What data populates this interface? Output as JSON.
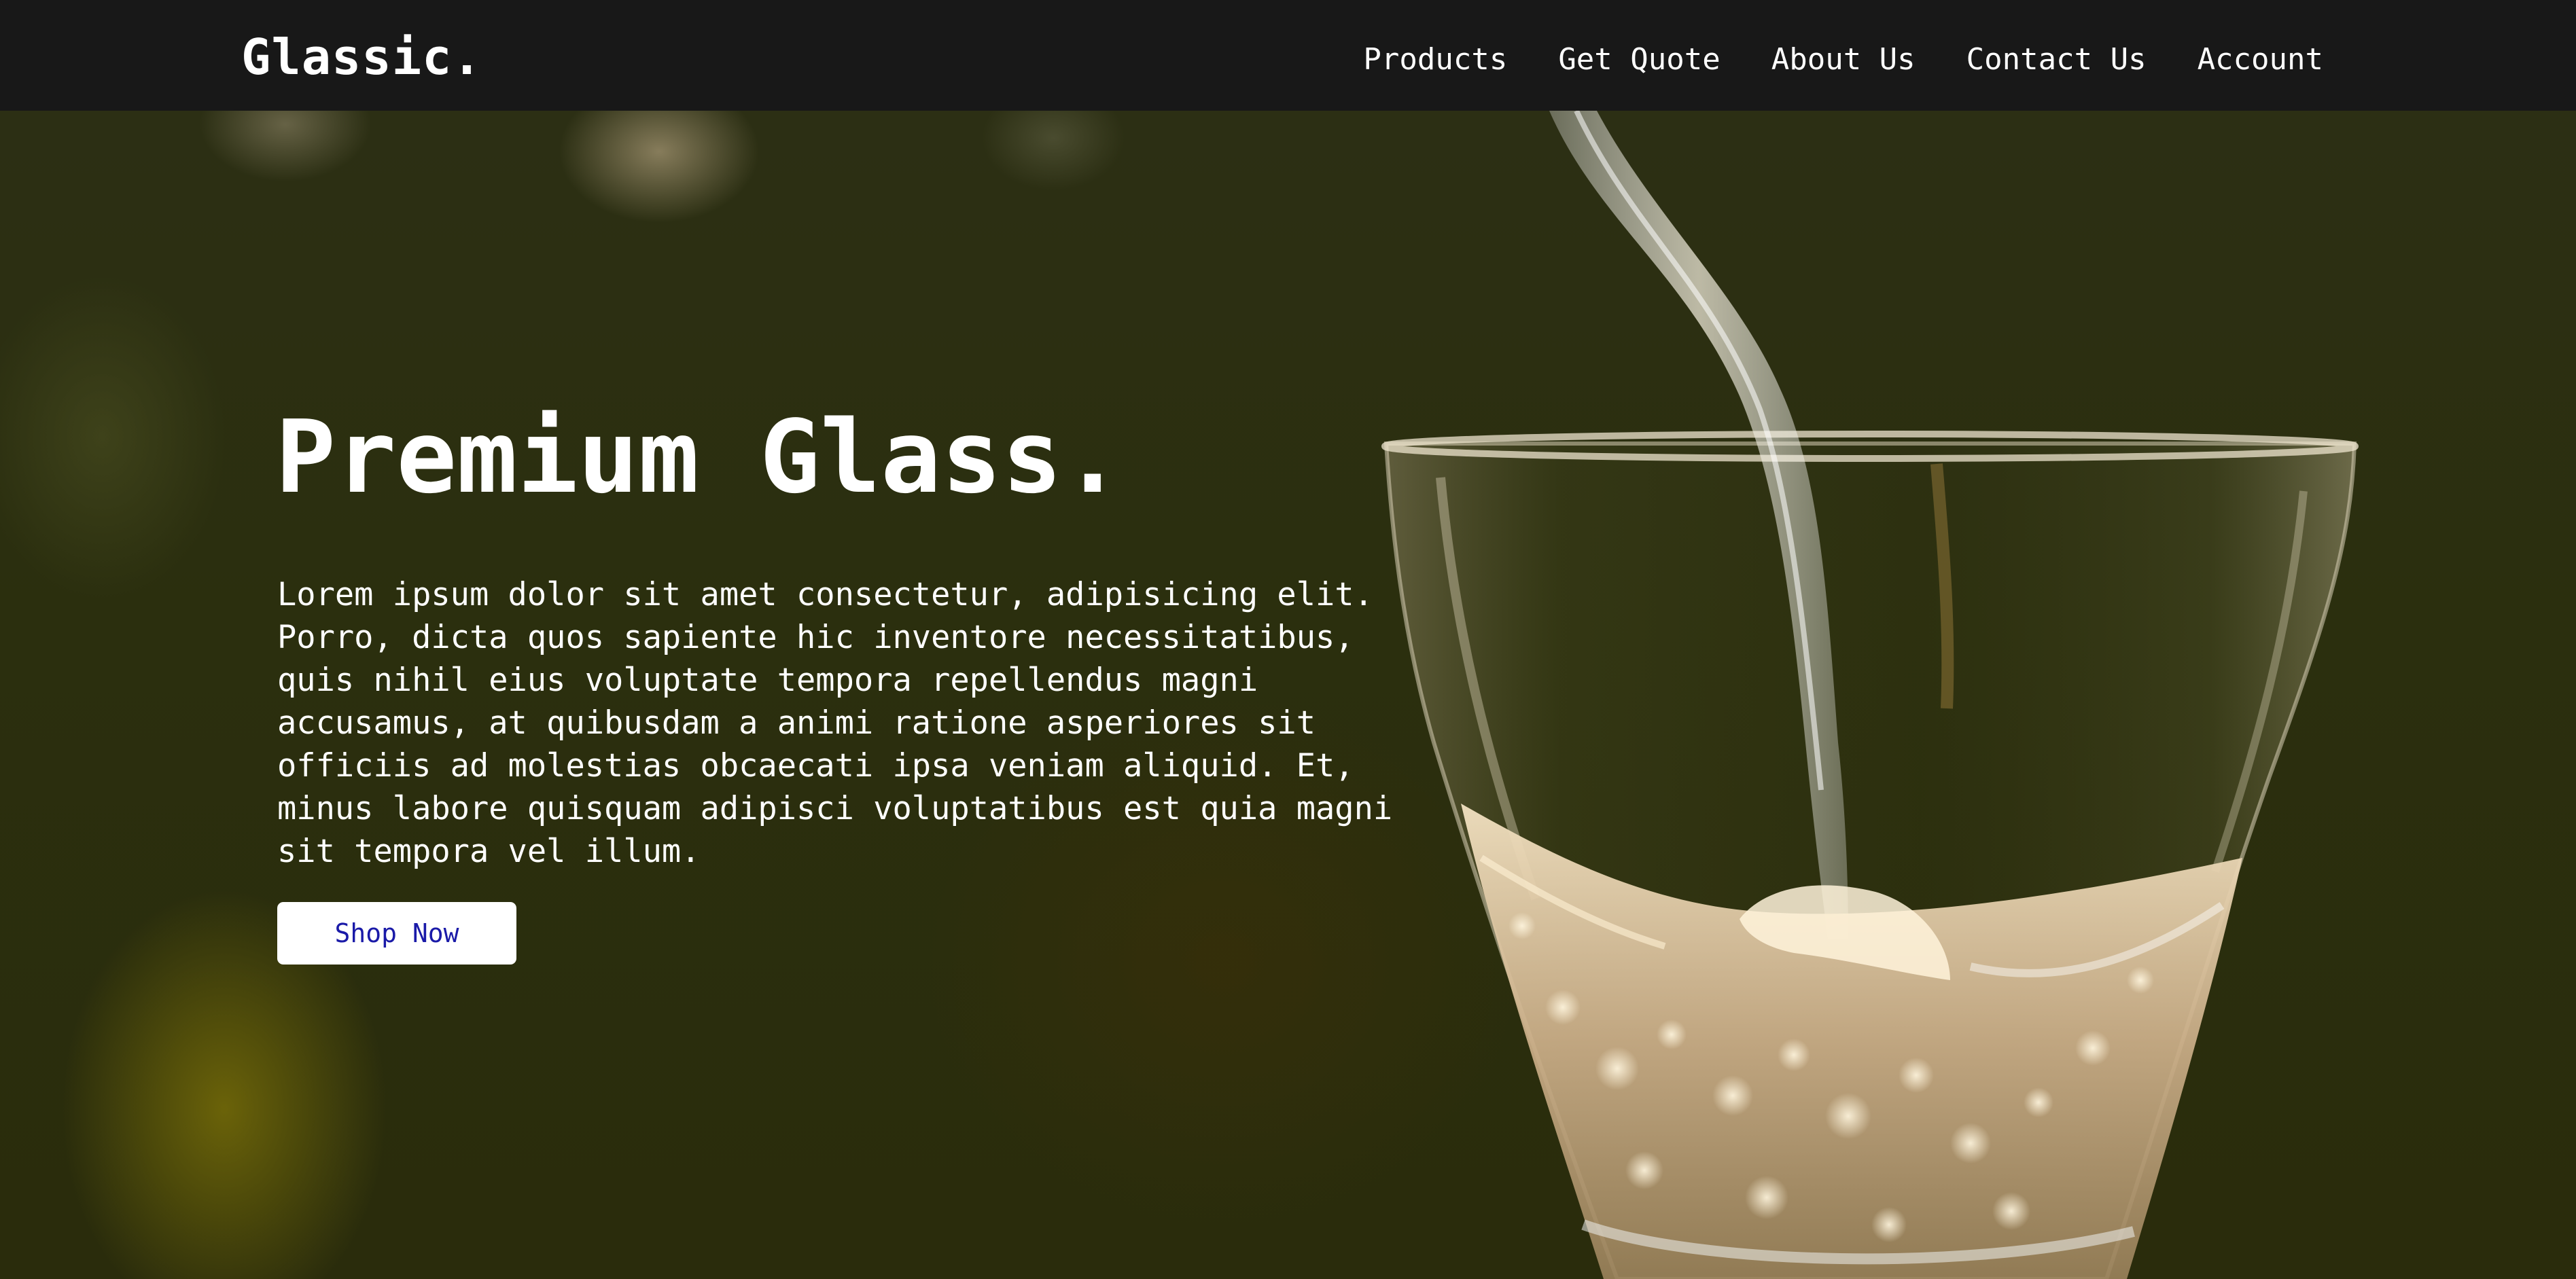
{
  "brand": {
    "logo_text": "Glassic."
  },
  "nav": {
    "items": [
      {
        "label": "Products"
      },
      {
        "label": "Get Quote"
      },
      {
        "label": "About Us"
      },
      {
        "label": "Contact Us"
      },
      {
        "label": "Account"
      }
    ]
  },
  "hero": {
    "title": "Premium Glass.",
    "body": "Lorem ipsum dolor sit amet consectetur, adipisicing elit.\nPorro, dicta quos sapiente hic inventore necessitatibus,\nquis nihil eius voluptate tempora repellendus magni\naccusamus, at quibusdam a animi ratione asperiores sit\nofficiis ad molestias obcaecati ipsa veniam aliquid. Et,\nminus labore quisquam adipisci voluptatibus est quia magni\nsit tempora vel illum.",
    "cta_label": "Shop Now",
    "image_subject": "wine-glass-pour"
  },
  "colors": {
    "navbar_bg": "#181818",
    "hero_bg": "#2b2f0e",
    "text": "#ffffff",
    "button_bg": "#ffffff",
    "button_text": "#1a1aa8"
  }
}
